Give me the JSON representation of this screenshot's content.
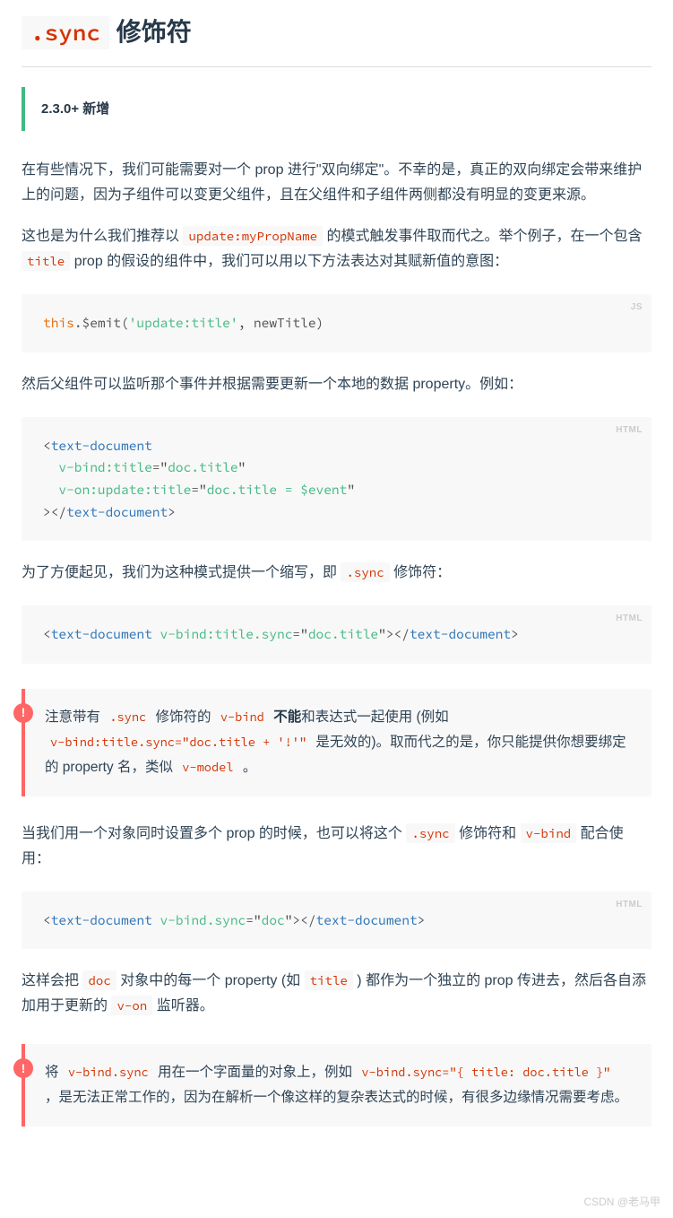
{
  "heading": {
    "code": ".sync",
    "suffix": " 修饰符"
  },
  "version_note": "2.3.0+ 新增",
  "para1": "在有些情况下，我们可能需要对一个 prop 进行\"双向绑定\"。不幸的是，真正的双向绑定会带来维护上的问题，因为子组件可以变更父组件，且在父组件和子组件两侧都没有明显的变更来源。",
  "para2": {
    "pre": "这也是为什么我们推荐以 ",
    "code1": "update:myPropName",
    "mid": " 的模式触发事件取而代之。举个例子，在一个包含 ",
    "code2": "title",
    "post": " prop 的假设的组件中，我们可以用以下方法表达对其赋新值的意图："
  },
  "code_js": {
    "lang": "JS",
    "this": "this",
    "emit": ".$emit(",
    "str": "'update:title'",
    "rest": ", newTitle)"
  },
  "para3": "然后父组件可以监听那个事件并根据需要更新一个本地的数据 property。例如：",
  "code_html1": {
    "lang": "HTML",
    "l1_open": "<",
    "l1_tag": "text-document",
    "l2_ind": "  ",
    "l2_attr": "v-bind:title",
    "l2_eq": "=",
    "l2_q1": "\"",
    "l2_val": "doc.title",
    "l2_q2": "\"",
    "l3_ind": "  ",
    "l3_attr": "v-on:update:title",
    "l3_eq": "=",
    "l3_q1": "\"",
    "l3_val": "doc.title = $event",
    "l3_q2": "\"",
    "l4_close_open": "></",
    "l4_tag": "text-document",
    "l4_close": ">"
  },
  "para4": {
    "pre": "为了方便起见，我们为这种模式提供一个缩写，即 ",
    "code": ".sync",
    "post": " 修饰符："
  },
  "code_html2": {
    "lang": "HTML",
    "open": "<",
    "tag": "text-document",
    "sp": " ",
    "attr": "v-bind:title.sync",
    "eq": "=",
    "q1": "\"",
    "val": "doc.title",
    "q2": "\"",
    "close_open": "></",
    "close_tag": "text-document",
    "close": ">"
  },
  "warn1": {
    "pre": "注意带有 ",
    "c1": ".sync",
    "mid1": " 修饰符的 ",
    "c2": "v-bind",
    "sp1": " ",
    "bold": "不能",
    "mid2": "和表达式一起使用 (例如 ",
    "c3": "v-bind:title.sync=\"doc.title + '!'\"",
    "mid3": " 是无效的)。取而代之的是，你只能提供你想要绑定的 property 名，类似 ",
    "c4": "v-model",
    "post": " 。"
  },
  "para5": {
    "pre": "当我们用一个对象同时设置多个 prop 的时候，也可以将这个 ",
    "c1": ".sync",
    "mid1": " 修饰符和 ",
    "c2": "v-bind",
    "post": " 配合使用："
  },
  "code_html3": {
    "lang": "HTML",
    "open": "<",
    "tag": "text-document",
    "sp": " ",
    "attr": "v-bind.sync",
    "eq": "=",
    "q1": "\"",
    "val": "doc",
    "q2": "\"",
    "close_open": "></",
    "close_tag": "text-document",
    "close": ">"
  },
  "para6": {
    "pre": "这样会把 ",
    "c1": "doc",
    "mid1": " 对象中的每一个 property (如 ",
    "c2": "title",
    "mid2": " ) 都作为一个独立的 prop 传进去，然后各自添加用于更新的 ",
    "c3": "v-on",
    "post": " 监听器。"
  },
  "warn2": {
    "pre": "将 ",
    "c1": "v-bind.sync",
    "mid1": " 用在一个字面量的对象上，例如 ",
    "c2": "v-bind.sync=\"{ title: doc.title }\"",
    "post": " ，是无法正常工作的，因为在解析一个像这样的复杂表达式的时候，有很多边缘情况需要考虑。"
  },
  "watermark": "CSDN @老马甲"
}
